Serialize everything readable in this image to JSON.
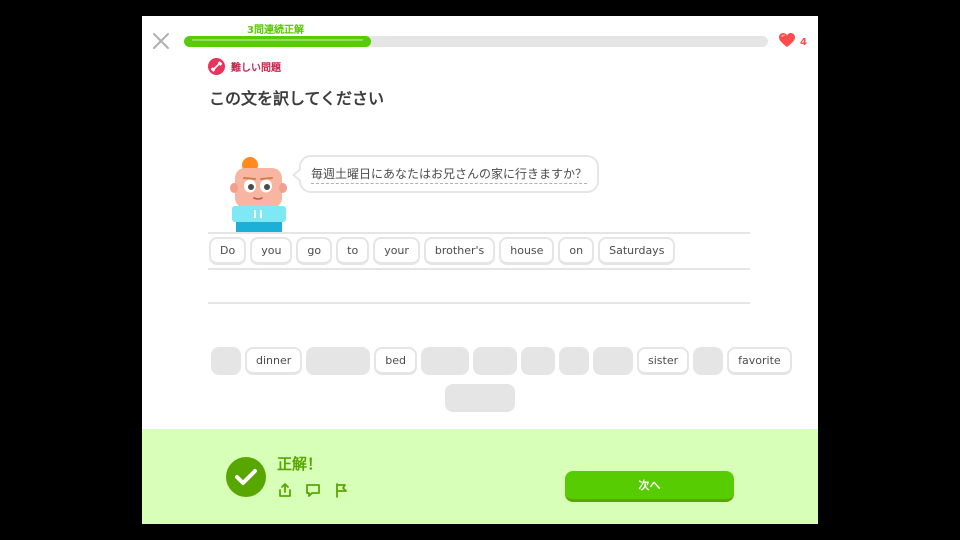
{
  "header": {
    "streak_label": "3問連続正解",
    "progress_percent": 32,
    "hearts_count": "4"
  },
  "challenge": {
    "badge_label": "難しい問題",
    "title": "この文を訳してください",
    "prompt_text": "毎週土曜日にあなたはお兄さんの家に行きますか？"
  },
  "answer_words": [
    "Do",
    "you",
    "go",
    "to",
    "your",
    "brother's",
    "house",
    "on",
    "Saturdays"
  ],
  "word_bank": {
    "row1": [
      {
        "type": "slot"
      },
      {
        "type": "word",
        "text": "dinner"
      },
      {
        "type": "slot"
      },
      {
        "type": "word",
        "text": "bed"
      },
      {
        "type": "slot"
      },
      {
        "type": "slot"
      },
      {
        "type": "slot"
      },
      {
        "type": "slot"
      },
      {
        "type": "slot"
      },
      {
        "type": "word",
        "text": "sister"
      },
      {
        "type": "slot"
      },
      {
        "type": "word",
        "text": "favorite"
      }
    ],
    "row2": [
      {
        "type": "slot"
      }
    ]
  },
  "footer": {
    "result_text": "正解！",
    "next_label": "次へ"
  },
  "colors": {
    "accent_green": "#58cc02",
    "dark_green": "#58a700",
    "footer_bg": "#d7ffb8",
    "heart_red": "#ff4b4b",
    "hard_badge": "#e8345a"
  },
  "icons": {
    "close": "close-icon",
    "heart": "heart-icon",
    "hard": "dumbbell-icon",
    "check": "check-icon",
    "share": "share-icon",
    "comment": "comment-icon",
    "report": "flag-icon"
  }
}
